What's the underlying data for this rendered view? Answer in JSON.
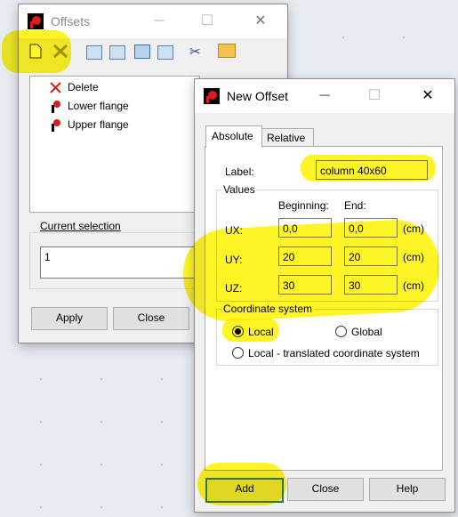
{
  "offsets_window": {
    "title": "Offsets",
    "toolbar_icons": [
      "new-document-icon",
      "delete-icon",
      "view-1-icon",
      "view-2-icon",
      "view-grid-icon",
      "view-table-icon",
      "cut-icon",
      "folder-star-icon"
    ],
    "list_items": [
      {
        "label": "Delete",
        "icon": "red-x-icon"
      },
      {
        "label": "Lower flange",
        "icon": "offset-icon"
      },
      {
        "label": "Upper flange",
        "icon": "offset-icon"
      }
    ],
    "current_selection_label": "Current selection",
    "current_selection_value": "1",
    "apply_label": "Apply",
    "close_label": "Close"
  },
  "new_offset_window": {
    "title": "New Offset",
    "tabs": [
      "Absolute",
      "Relative"
    ],
    "label_caption": "Label:",
    "label_value": "column 40x60",
    "values_caption": "Values",
    "col_beginning": "Beginning:",
    "col_end": "End:",
    "rows": [
      {
        "name": "UX:",
        "beginning": "0,0",
        "end": "0,0",
        "unit": "(cm)"
      },
      {
        "name": "UY:",
        "beginning": "20",
        "end": "20",
        "unit": "(cm)"
      },
      {
        "name": "UZ:",
        "beginning": "30",
        "end": "30",
        "unit": "(cm)"
      }
    ],
    "coord_caption": "Coordinate system",
    "coord_options": [
      "Local",
      "Global",
      "Local - translated coordinate system"
    ],
    "coord_selected": "Local",
    "add_label": "Add",
    "close_label": "Close",
    "help_label": "Help"
  },
  "colors": {
    "highlight": "#fff200",
    "accent_red": "#e01b1b",
    "add_border": "#2f7d32"
  }
}
